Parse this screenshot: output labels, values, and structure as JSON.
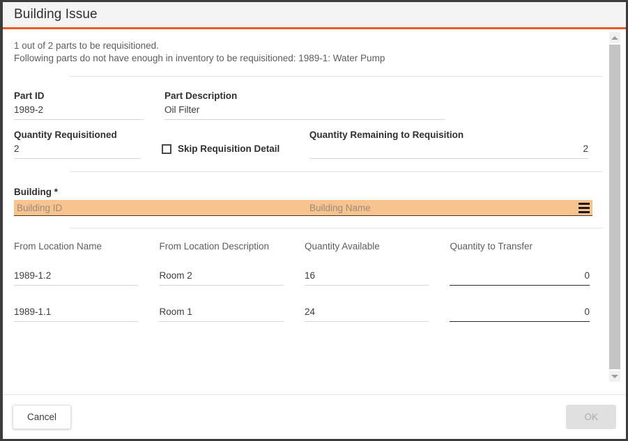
{
  "window": {
    "title": "Building Issue"
  },
  "messages": {
    "line1": "1 out of 2 parts to be requisitioned.",
    "line2": "Following parts do not have enough in inventory to be requisitioned: 1989-1: Water Pump"
  },
  "form": {
    "part_id": {
      "label": "Part ID",
      "value": "1989-2"
    },
    "part_description": {
      "label": "Part Description",
      "value": "Oil Filter"
    },
    "quantity_requisitioned": {
      "label": "Quantity Requisitioned",
      "value": "2"
    },
    "skip_requisition_detail": {
      "label": "Skip Requisition Detail",
      "checked": false
    },
    "quantity_remaining": {
      "label": "Quantity Remaining to Requisition",
      "value": "2"
    },
    "building": {
      "label": "Building *",
      "placeholder_id": "Building ID",
      "placeholder_name": "Building Name",
      "value": "",
      "highlight_color": "#f7c38e",
      "lookup_icon": "list-menu-icon"
    }
  },
  "grid": {
    "columns": [
      "From Location Name",
      "From Location Description",
      "Quantity Available",
      "Quantity to Transfer"
    ],
    "rows": [
      {
        "location_name": "1989-1.2",
        "location_description": "Room 2",
        "quantity_available": "16",
        "quantity_to_transfer": "0"
      },
      {
        "location_name": "1989-1.1",
        "location_description": "Room 1",
        "quantity_available": "24",
        "quantity_to_transfer": "0"
      }
    ]
  },
  "footer": {
    "cancel_label": "Cancel",
    "ok_label": "OK",
    "ok_disabled": true
  },
  "theme": {
    "accent": "#eb5a1e",
    "titlebar_bg": "#f4f4f4",
    "frame": "#3c3c3c",
    "highlight": "#f7c38e"
  },
  "scrollbar": {
    "up_icon": "chevron-up-icon",
    "down_icon": "chevron-down-icon"
  }
}
